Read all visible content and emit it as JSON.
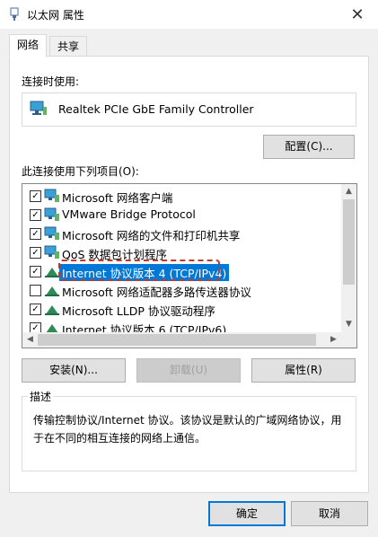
{
  "window": {
    "title": "以太网 属性"
  },
  "tabs": [
    {
      "label": "网络"
    },
    {
      "label": "共享"
    }
  ],
  "connect_using": {
    "label": "连接时使用:",
    "adapter": "Realtek PCIe GbE Family Controller",
    "configure_button": "配置(C)..."
  },
  "items_section": {
    "label": "此连接使用下列项目(O):",
    "items": [
      {
        "label": "Microsoft 网络客户端",
        "checked": true
      },
      {
        "label": "VMware Bridge Protocol",
        "checked": true
      },
      {
        "label": "Microsoft 网络的文件和打印机共享",
        "checked": true
      },
      {
        "label": "QoS 数据包计划程序",
        "checked": true
      },
      {
        "label": "Internet 协议版本 4 (TCP/IPv4)",
        "checked": true,
        "selected": true
      },
      {
        "label": "Microsoft 网络适配器多路传送器协议",
        "checked": false
      },
      {
        "label": "Microsoft LLDP 协议驱动程序",
        "checked": true
      },
      {
        "label": "Internet 协议版本 6 (TCP/IPv6)",
        "checked": true
      }
    ]
  },
  "actions": {
    "install": "安装(N)...",
    "uninstall": "卸载(U)",
    "properties": "属性(R)"
  },
  "description": {
    "title": "描述",
    "text": "传输控制协议/Internet 协议。该协议是默认的广域网络协议，用于在不同的相互连接的网络上通信。"
  },
  "footer": {
    "ok": "确定",
    "cancel": "取消"
  },
  "colors": {
    "selection": "#0078d7",
    "highlight_outline": "#c0392b",
    "focus_border": "#0078d7"
  }
}
